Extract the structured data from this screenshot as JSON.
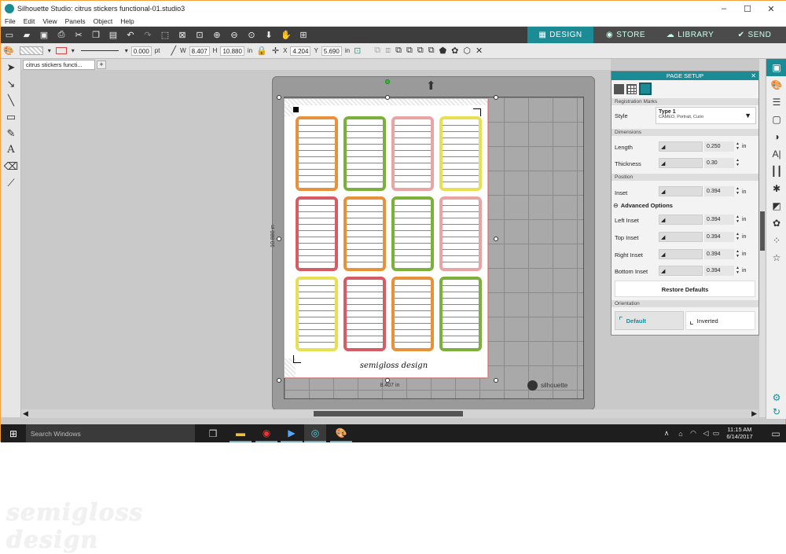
{
  "window": {
    "title": "Silhouette Studio: citrus stickers functional-01.studio3",
    "minimize": "–",
    "maximize": "☐",
    "close": "✕"
  },
  "menu": [
    "File",
    "Edit",
    "View",
    "Panels",
    "Object",
    "Help"
  ],
  "nav_tabs": [
    {
      "label": "DESIGN",
      "icon": "grid-icon"
    },
    {
      "label": "STORE",
      "icon": "s-logo-icon"
    },
    {
      "label": "LIBRARY",
      "icon": "cloud-icon"
    },
    {
      "label": "SEND",
      "icon": "check-icon"
    }
  ],
  "toolbar2": {
    "line_width": "0.000",
    "line_unit": "pt",
    "w_label": "W",
    "w_value": "8.407",
    "h_label": "H",
    "h_value": "10.880",
    "size_unit": "in",
    "x_label": "X",
    "x_value": "4.204",
    "y_label": "Y",
    "y_value": "5.690",
    "pos_unit": "in"
  },
  "document_tab": "citrus stickers functi...",
  "add_tab": "+",
  "page": {
    "width_label": "8.407 in",
    "height_label": "10.880 in",
    "watermark_text": "semigloss design",
    "sticker_colors": [
      [
        "#e8913a",
        "#7bb03a",
        "#e8a5a3",
        "#e8e052"
      ],
      [
        "#d75b62",
        "#e8913a",
        "#7bb03a",
        "#e8a5a3"
      ],
      [
        "#e8e052",
        "#d75b62",
        "#e8913a",
        "#7bb03a"
      ]
    ]
  },
  "mat_brand": "silhouette",
  "panel": {
    "title": "PAGE SETUP",
    "close": "✕",
    "registration_marks_section": "Registration Marks",
    "style_label": "Style",
    "style_value": "Type 1",
    "style_sub": "CAMEO, Portrait, Curio",
    "dimensions_section": "Dimensions",
    "length_label": "Length",
    "length_value": "0.250",
    "length_unit": "in",
    "thickness_label": "Thickness",
    "thickness_value": "0.30",
    "position_section": "Position",
    "inset_label": "Inset",
    "inset_value": "0.394",
    "inset_unit": "in",
    "advanced_label": "Advanced Options",
    "left_inset_label": "Left Inset",
    "left_inset_value": "0.394",
    "top_inset_label": "Top Inset",
    "top_inset_value": "0.394",
    "right_inset_label": "Right Inset",
    "right_inset_value": "0.394",
    "bottom_inset_label": "Bottom Inset",
    "bottom_inset_value": "0.394",
    "unit": "in",
    "restore_defaults": "Restore Defaults",
    "orientation_section": "Orientation",
    "orientation_default": "Default",
    "orientation_inverted": "Inverted"
  },
  "taskbar": {
    "search_placeholder": "Search Windows",
    "time": "11:15 AM",
    "date": "6/14/2017"
  },
  "watermark": "semigloss design",
  "colors": {
    "accent": "#1b8c96",
    "toolbar": "#3d3d3d",
    "taskbar": "#1e1e1e"
  }
}
